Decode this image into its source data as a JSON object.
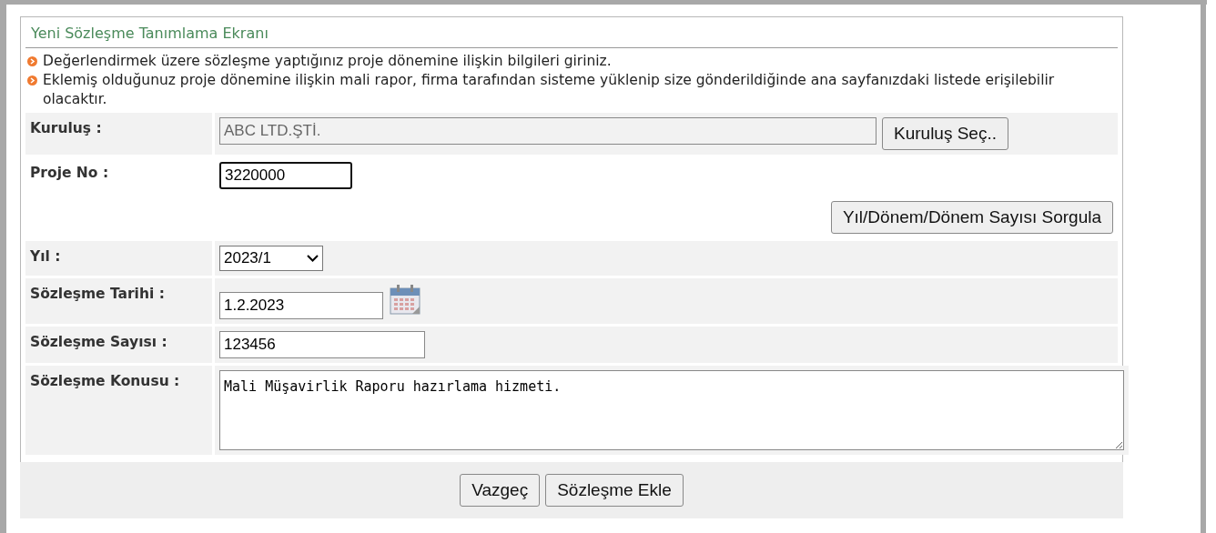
{
  "panel": {
    "title": "Yeni Sözleşme Tanımlama Ekranı"
  },
  "notes": [
    "Değerlendirmek üzere sözleşme yaptığınız proje dönemine ilişkin bilgileri giriniz.",
    "Eklemiş olduğunuz proje dönemine ilişkin mali rapor, firma tarafından sisteme yüklenip size gönderildiğinde ana sayfanızdaki listede erişilebilir olacaktır."
  ],
  "fields": [
    {
      "kind": "text",
      "label": "Kuruluş :",
      "value": "ABC LTD.ŞTİ.",
      "disabled": true,
      "focused": false,
      "button": "Kuruluş Seç.."
    },
    {
      "kind": "text",
      "label": "Proje No :",
      "value": "3220000",
      "disabled": false,
      "focused": true
    },
    {
      "kind": "action",
      "button": "Yıl/Dönem/Dönem Sayısı Sorgula"
    },
    {
      "kind": "select",
      "label": "Yıl :",
      "value": "2023/1"
    },
    {
      "kind": "date",
      "label": "Sözleşme Tarihi :",
      "value": "1.2.2023"
    },
    {
      "kind": "text",
      "label": "Sözleşme Sayısı :",
      "value": "123456",
      "disabled": false,
      "focused": false
    },
    {
      "kind": "textarea",
      "label": "Sözleşme Konusu :",
      "value": "Mali Müşavirlik Raporu hazırlama hizmeti."
    }
  ],
  "buttons": [
    "Vazgeç",
    "Sözleşme Ekle"
  ]
}
